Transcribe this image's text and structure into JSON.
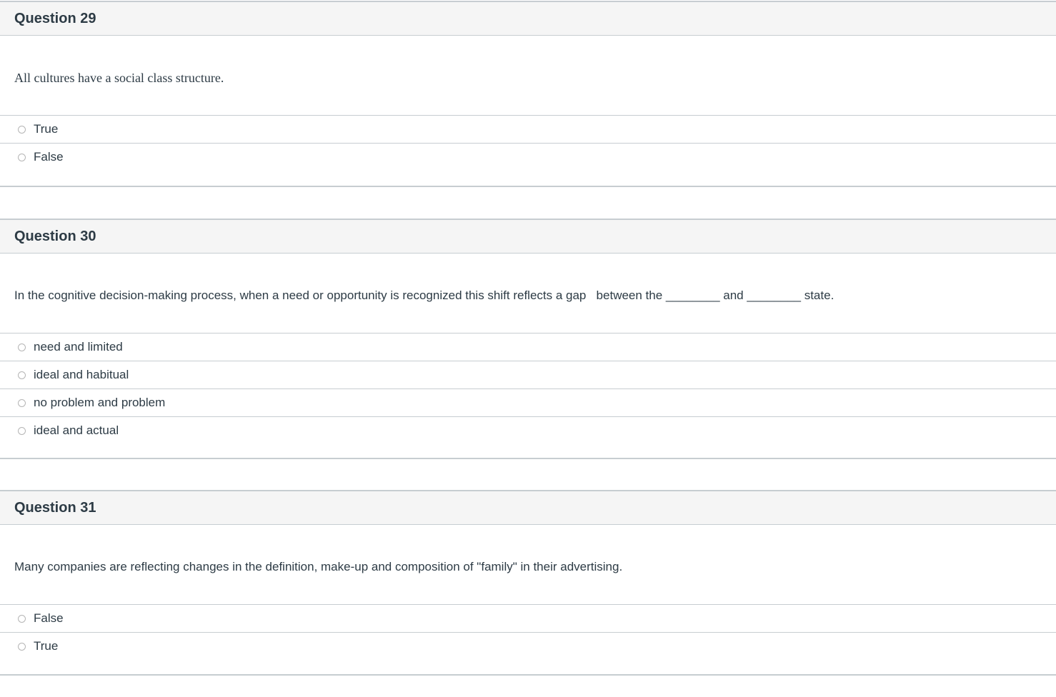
{
  "questions": [
    {
      "title": "Question 29",
      "text": "All cultures have a social class structure.",
      "answers": [
        "True",
        "False"
      ]
    },
    {
      "title": "Question 30",
      "text": "In the cognitive decision-making process, when a need or opportunity is recognized this shift reflects a gap   between the ________ and ________ state.",
      "answers": [
        "need and limited",
        "ideal and habitual",
        "no problem and problem",
        "ideal and actual"
      ]
    },
    {
      "title": "Question 31",
      "text": "Many companies are reflecting changes in the definition, make-up and composition of \"family\" in their advertising.",
      "answers": [
        "False",
        "True"
      ]
    }
  ]
}
